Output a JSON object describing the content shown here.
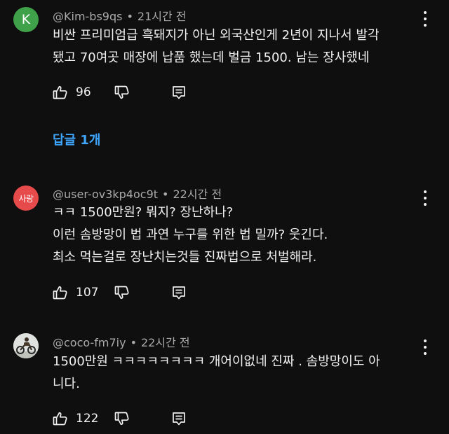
{
  "comments": [
    {
      "avatar_letter": "K",
      "avatar_color": "#3fa24b",
      "handle": "@Kim-bs9qs",
      "separator": "•",
      "time": "21시간 전",
      "lines": [
        "비싼 프리미엄급 흑돼지가 아닌 외국산인게 2년이 지나서 발각",
        "됐고 70여곳 매장에 납품 했는데 벌금  1500. 남는 장사했네"
      ],
      "likes": "96",
      "replies_label": "답글 1개"
    },
    {
      "avatar_text": "사랑",
      "avatar_color": "#e74a4a",
      "handle": "@user-ov3kp4oc9t",
      "separator": "•",
      "time": "22시간 전",
      "lines": [
        "ㅋㅋ 1500만원? 뭐지? 장난하나?",
        "이런 솜방망이 법 과연 누구를 위한 법 밀까? 웃긴다.",
        "최소 먹는걸로 장난치는것들 진짜법으로 처벌해라."
      ],
      "likes": "107"
    },
    {
      "handle": "@coco-fm7iy",
      "separator": "•",
      "time": "22시간 전",
      "lines": [
        "1500만원 ㅋㅋㅋㅋㅋㅋㅋㅋ 개어이없네 진짜 . 솜방망이도 아",
        "니다."
      ],
      "likes": "122"
    }
  ],
  "icons": {
    "like": "thumbs-up-icon",
    "dislike": "thumbs-down-icon",
    "reply": "comment-reply-icon",
    "more": "more-vertical-icon"
  },
  "colors": {
    "background": "#0f0f0f",
    "text": "#f1f1f1",
    "secondary_text": "#aaaaaa",
    "link": "#3ea6ff"
  }
}
